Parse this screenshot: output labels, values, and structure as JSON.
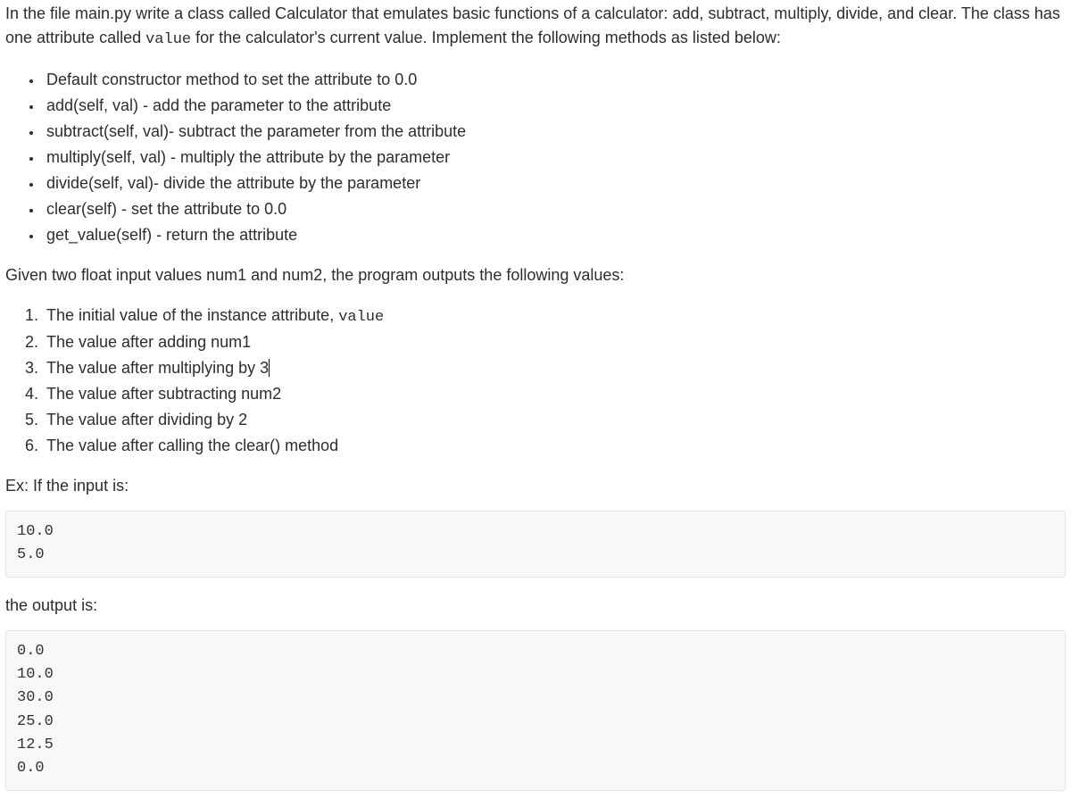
{
  "intro": {
    "prefix": "In the file main.py write a class called Calculator that emulates basic functions of a calculator: add, subtract, multiply, divide, and clear. The class has one attribute called ",
    "code_attr": "value",
    "suffix": " for the calculator's current value. Implement the following methods as listed below:"
  },
  "methods": [
    "Default constructor method to set the attribute to 0.0",
    "add(self, val) - add the parameter to the attribute",
    "subtract(self, val)- subtract the parameter from the attribute",
    "multiply(self, val) - multiply the attribute by the parameter",
    "divide(self, val)- divide the attribute by the parameter",
    "clear(self) - set the attribute to 0.0",
    "get_value(self) - return the attribute"
  ],
  "given": "Given two float input values num1 and num2, the program outputs the following values:",
  "steps": {
    "s1_pre": "The initial value of the instance attribute, ",
    "s1_code": "value",
    "s2": "The value after adding num1",
    "s3": "The value after multiplying by 3",
    "s4": "The value after subtracting num2",
    "s5": "The value after dividing by 2",
    "s6": "The value after calling the clear() method"
  },
  "ex_label": "Ex: If the input is:",
  "input_block": "10.0\n5.0",
  "output_label": "the output is:",
  "output_block": "0.0\n10.0\n30.0\n25.0\n12.5\n0.0"
}
